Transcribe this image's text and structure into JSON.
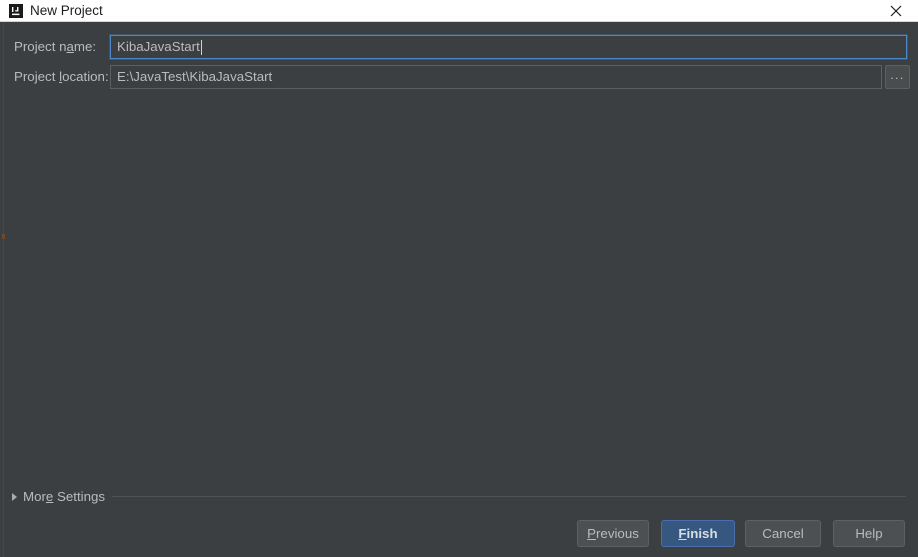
{
  "window": {
    "title": "New Project",
    "app_icon": "intellij-idea-logo-icon",
    "close_icon": "close-icon",
    "background_color": "#3c3f41",
    "titlebar_color": "#ffffff"
  },
  "form": {
    "project_name": {
      "label_prefix": "Project n",
      "label_mnemonic": "a",
      "label_suffix": "me:",
      "value": "KibaJavaStart",
      "focused": true,
      "border_color": "#4a88c7"
    },
    "project_location": {
      "label_prefix": "Project ",
      "label_mnemonic": "l",
      "label_suffix": "ocation:",
      "value": "E:\\JavaTest\\KibaJavaStart",
      "focused": false,
      "border_color": "#5e6060"
    },
    "browse_button": {
      "label": "...",
      "icon": "ellipsis-icon"
    }
  },
  "more_settings": {
    "prefix": "Mor",
    "mnemonic": "e",
    "suffix": " Settings",
    "expanded": false,
    "disclosure_icon": "triangle-right-icon"
  },
  "buttons": {
    "previous": {
      "mnemonic": "P",
      "rest": "revious",
      "default": false
    },
    "finish": {
      "mnemonic": "F",
      "rest": "inish",
      "default": true,
      "color": "#365880"
    },
    "cancel": {
      "label": "Cancel",
      "default": false
    },
    "help": {
      "label": "Help",
      "default": false
    }
  }
}
